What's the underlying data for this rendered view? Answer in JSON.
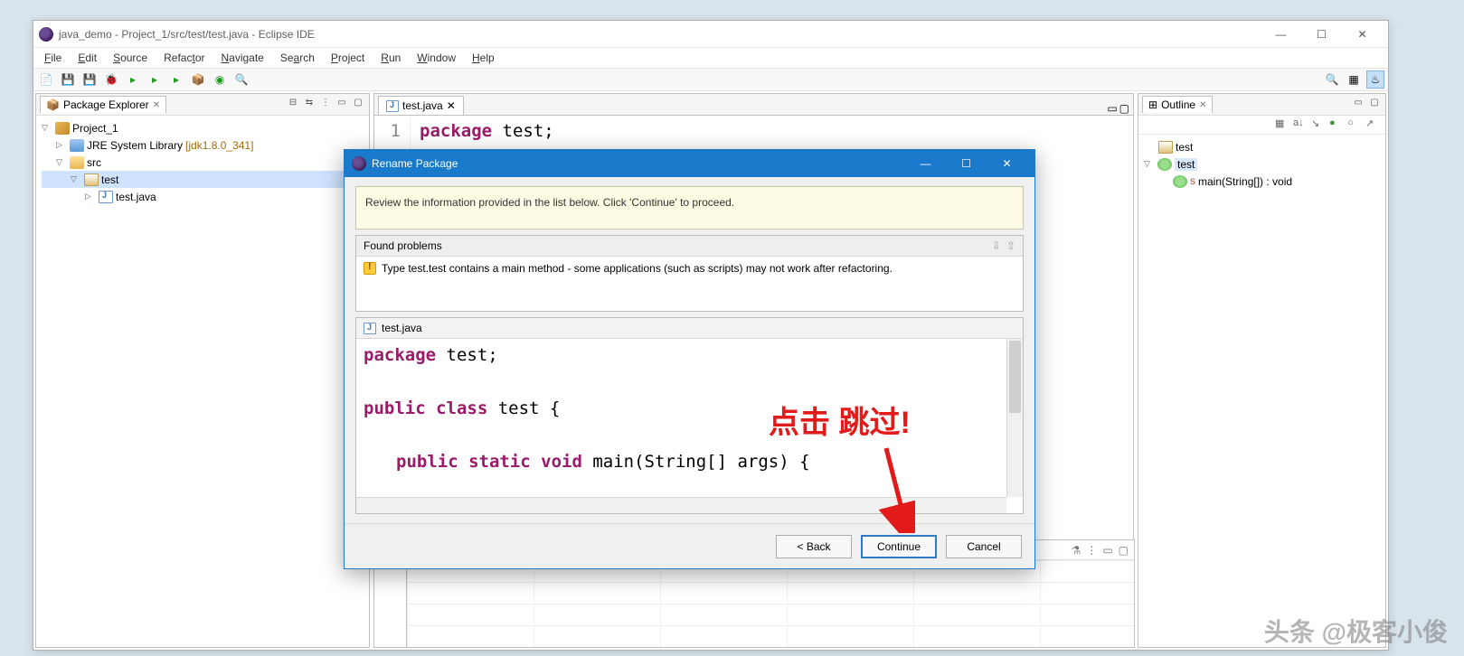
{
  "window": {
    "title": "java_demo - Project_1/src/test/test.java - Eclipse IDE"
  },
  "menu": [
    "File",
    "Edit",
    "Source",
    "Refactor",
    "Navigate",
    "Search",
    "Project",
    "Run",
    "Window",
    "Help"
  ],
  "package_explorer": {
    "title": "Package Explorer",
    "project": "Project_1",
    "library": "JRE System Library",
    "library_ver": "[jdk1.8.0_341]",
    "src": "src",
    "pkg": "test",
    "file": "test.java"
  },
  "editor": {
    "tab": "test.java",
    "line_no": "1",
    "code_kw": "package",
    "code_rest": " test;"
  },
  "outline": {
    "title": "Outline",
    "pkg": "test",
    "cls": "test",
    "method": "main(String[]) : void"
  },
  "dialog": {
    "title": "Rename Package",
    "info": "Review the information provided in the list below. Click 'Continue' to proceed.",
    "found_problems": "Found problems",
    "problem_text": "Type test.test contains a main method - some applications (such as scripts) may not work after refactoring.",
    "preview_tab": "test.java",
    "preview_line1_kw": "package",
    "preview_line1_rest": " test;",
    "preview_line3_kw": "public class",
    "preview_line3_rest": " test {",
    "preview_line5_kw": "public static void",
    "preview_line5_rest": " main(String[] args) {",
    "btn_back": "< Back",
    "btn_continue": "Continue",
    "btn_cancel": "Cancel"
  },
  "annotation": "点击 跳过!",
  "watermark": "头条 @极客小俊"
}
